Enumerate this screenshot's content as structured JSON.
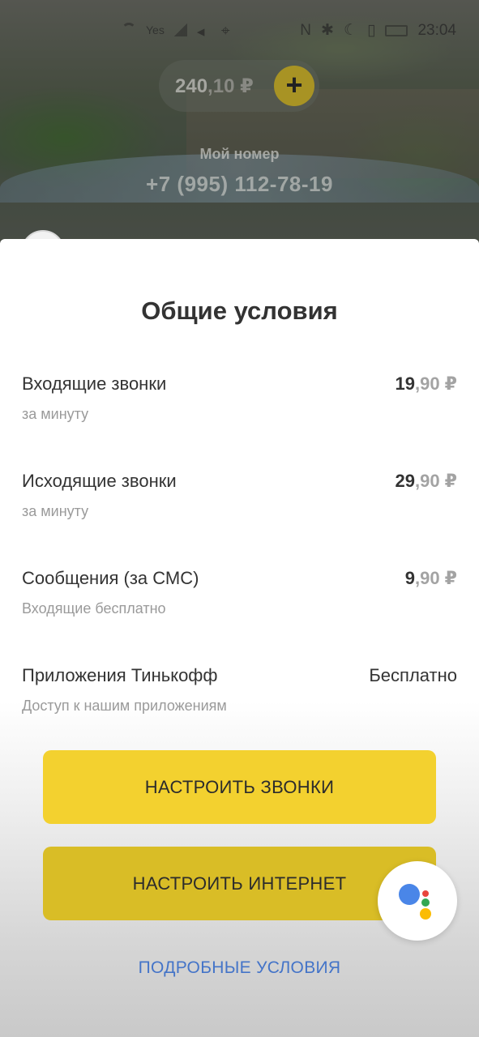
{
  "status_bar": {
    "carrier_indicator": "Yes",
    "time": "23:04"
  },
  "header": {
    "balance_whole": "240",
    "balance_fraction": ",10 ₽",
    "add_icon": "plus-icon",
    "my_number_label": "Мой номер",
    "my_number": "+7 (995) 112-78-19"
  },
  "sheet": {
    "title": "Общие условия",
    "rows": [
      {
        "title": "Входящие звонки",
        "subtitle": "за минуту",
        "price_whole": "19",
        "price_fraction": ",90 ₽"
      },
      {
        "title": "Исходящие звонки",
        "subtitle": "за минуту",
        "price_whole": "29",
        "price_fraction": ",90 ₽"
      },
      {
        "title": "Сообщения (за СМС)",
        "subtitle": "Входящие бесплатно",
        "price_whole": "9",
        "price_fraction": ",90 ₽"
      },
      {
        "title": "Приложения Тинькофф",
        "subtitle": "Доступ к нашим приложениям",
        "price_text": "Бесплатно"
      }
    ],
    "buttons": {
      "calls": "НАСТРОИТЬ ЗВОНКИ",
      "internet": "НАСТРОИТЬ ИНТЕРНЕТ"
    },
    "details_link": "ПОДРОБНЫЕ УСЛОВИЯ"
  },
  "assistant": {
    "icon": "google-assistant-icon"
  },
  "colors": {
    "accent_yellow": "#f3d12f",
    "link_blue": "#4474c8",
    "text_dark": "#333333",
    "text_muted": "#9a9a9a"
  }
}
